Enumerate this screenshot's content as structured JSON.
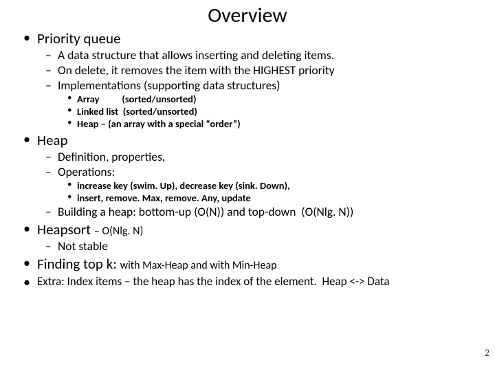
{
  "title": "Overview",
  "page_number": "2",
  "sections": {
    "pq": {
      "heading": "Priority queue",
      "items": [
        "A data structure that allows inserting and deleting items.",
        "On delete, it removes the item with the HIGHEST priority",
        "Implementations (supporting data structures)"
      ],
      "impls": [
        "Array          (sorted/unsorted)",
        "Linked list  (sorted/unsorted)",
        "Heap – (an array with a special “order”)"
      ]
    },
    "heap": {
      "heading": "Heap",
      "items": [
        "Definition, properties,",
        "Operations:"
      ],
      "ops": [
        "increase key (swim. Up), decrease key (sink. Down),",
        "insert, remove. Max, remove. Any, update"
      ],
      "build": "Building a heap: bottom-up (O(N)) and top-down  (O(Nlg. N))"
    },
    "heapsort": {
      "heading": "Heapsort",
      "note": "– O(Nlg. N)",
      "items": [
        "Not stable"
      ]
    },
    "topk": {
      "heading": "Finding top k:",
      "note": "with Max-Heap and with Min-Heap"
    },
    "extra": {
      "text": "Extra: Index items – the heap has the index of the element.  Heap <-> Data"
    }
  }
}
